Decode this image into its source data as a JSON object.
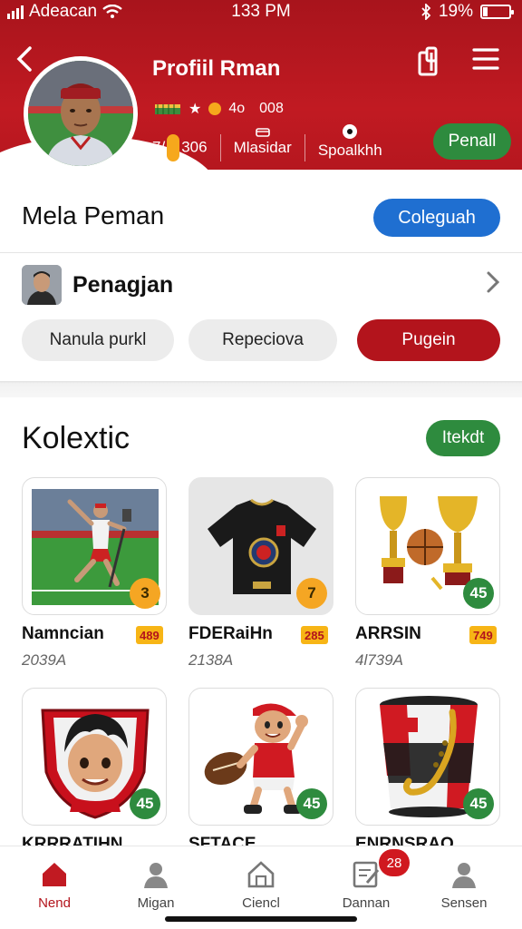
{
  "status_bar": {
    "carrier": "Adeacan",
    "time": "133 PM",
    "battery": "19%"
  },
  "header": {
    "title": "Profiil Rman",
    "badge_text": "4o",
    "badge_num": "008",
    "stat_value": "7/",
    "stat_value2": "306",
    "stat2_label": "Mlasidar",
    "stat3_label": "Spoalkhh",
    "action_label": "Penall",
    "accent": "#c11a22"
  },
  "section_one": {
    "title": "Mela Peman",
    "action_label": "Coleguah",
    "person_name": "Penagjan",
    "pills": [
      "Nanula purkl",
      "Repeciova",
      "Pugein"
    ]
  },
  "collection": {
    "title": "Kolextic",
    "action_label": "Itekdt",
    "items": [
      {
        "name": "Namncian",
        "sub": "2039A",
        "badge": "3",
        "price": "489",
        "image": "football-player"
      },
      {
        "name": "FDERaiHn",
        "sub": "2138A",
        "badge": "7",
        "price": "285",
        "image": "black-jersey"
      },
      {
        "name": "ARRSIN",
        "sub": "4l739A",
        "badge": "45",
        "price": "749",
        "image": "trophies-and-ball"
      },
      {
        "name": "KRRRATIHN",
        "sub": "",
        "badge": "45",
        "price": "",
        "image": "cartoon-crest"
      },
      {
        "name": "SFTACE",
        "sub": "",
        "badge": "45",
        "price": "",
        "image": "cartoon-rugby-player"
      },
      {
        "name": "ENRNSRAO",
        "sub": "",
        "badge": "45",
        "price": "",
        "image": "saxophone-drum"
      }
    ]
  },
  "bottom_nav": {
    "items": [
      {
        "label": "Nend",
        "icon": "home-icon"
      },
      {
        "label": "Migan",
        "icon": "person-icon"
      },
      {
        "label": "Ciencl",
        "icon": "house-outline-icon"
      },
      {
        "label": "Dannan",
        "icon": "document-edit-icon"
      },
      {
        "label": "Sensen",
        "icon": "user-icon"
      }
    ],
    "notification_count": "28"
  }
}
